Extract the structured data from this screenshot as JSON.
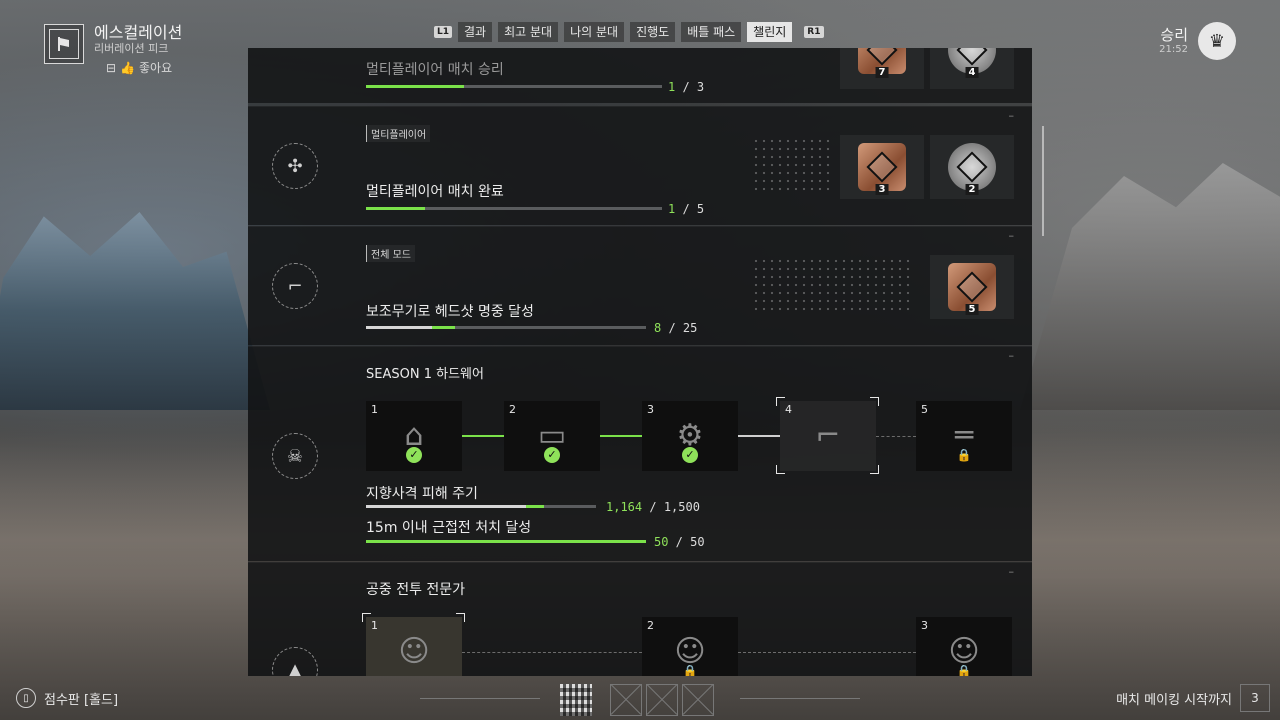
{
  "player": {
    "name": "에스컬레이션",
    "subtitle": "리버레이션 피크",
    "like_label": "좋아요"
  },
  "tabs": {
    "left_key": "L1",
    "right_key": "R1",
    "items": [
      {
        "label": "결과",
        "active": false
      },
      {
        "label": "최고 분대",
        "active": false
      },
      {
        "label": "나의 분대",
        "active": false
      },
      {
        "label": "진행도",
        "active": false
      },
      {
        "label": "배틀 패스",
        "active": false
      },
      {
        "label": "챌린지",
        "active": true
      }
    ]
  },
  "match": {
    "result": "승리",
    "time": "21:52"
  },
  "challenges": [
    {
      "title": "멀티플레이어 매치 승리",
      "current": "1",
      "total": "3",
      "progress": 0.33,
      "rewards": [
        "7",
        "4"
      ]
    },
    {
      "category": "멀티플레이어",
      "title": "멀티플레이어 매치 완료",
      "current": "1",
      "total": "5",
      "progress": 0.2,
      "icon": "crossed-blades-icon",
      "rewards": [
        {
          "type": "bronze",
          "level": "3"
        },
        {
          "type": "silver",
          "level": "2"
        }
      ]
    },
    {
      "category": "전체 모드",
      "title": "보조무기로 헤드샷 명중 달성",
      "current": "8",
      "total": "25",
      "progress": 0.32,
      "icon": "pistol-icon",
      "rewards": [
        {
          "type": "bronze",
          "level": "5"
        }
      ]
    },
    {
      "title": "SEASON 1 하드웨어",
      "icon": "skull-crossbones-icon",
      "slots": [
        {
          "num": "1",
          "state": "complete"
        },
        {
          "num": "2",
          "state": "complete"
        },
        {
          "num": "3",
          "state": "complete"
        },
        {
          "num": "4",
          "state": "current"
        },
        {
          "num": "5",
          "state": "locked"
        }
      ],
      "tasks": [
        {
          "title": "지향사격 피해 주기",
          "current": "1,164",
          "total": "1,500",
          "progress": 0.776
        },
        {
          "title": "15m 이내 근접전 처치 달성",
          "current": "50",
          "total": "50",
          "progress": 1.0
        }
      ]
    },
    {
      "title": "공중 전투 전문가",
      "slots": [
        {
          "num": "1",
          "state": "current"
        },
        {
          "num": "2",
          "state": "locked"
        },
        {
          "num": "3",
          "state": "locked"
        }
      ]
    }
  ],
  "bottom": {
    "scoreboard_label": "점수판 [홀드]",
    "matchmaking_label": "매치 메이킹 시작까지",
    "countdown": "3"
  }
}
